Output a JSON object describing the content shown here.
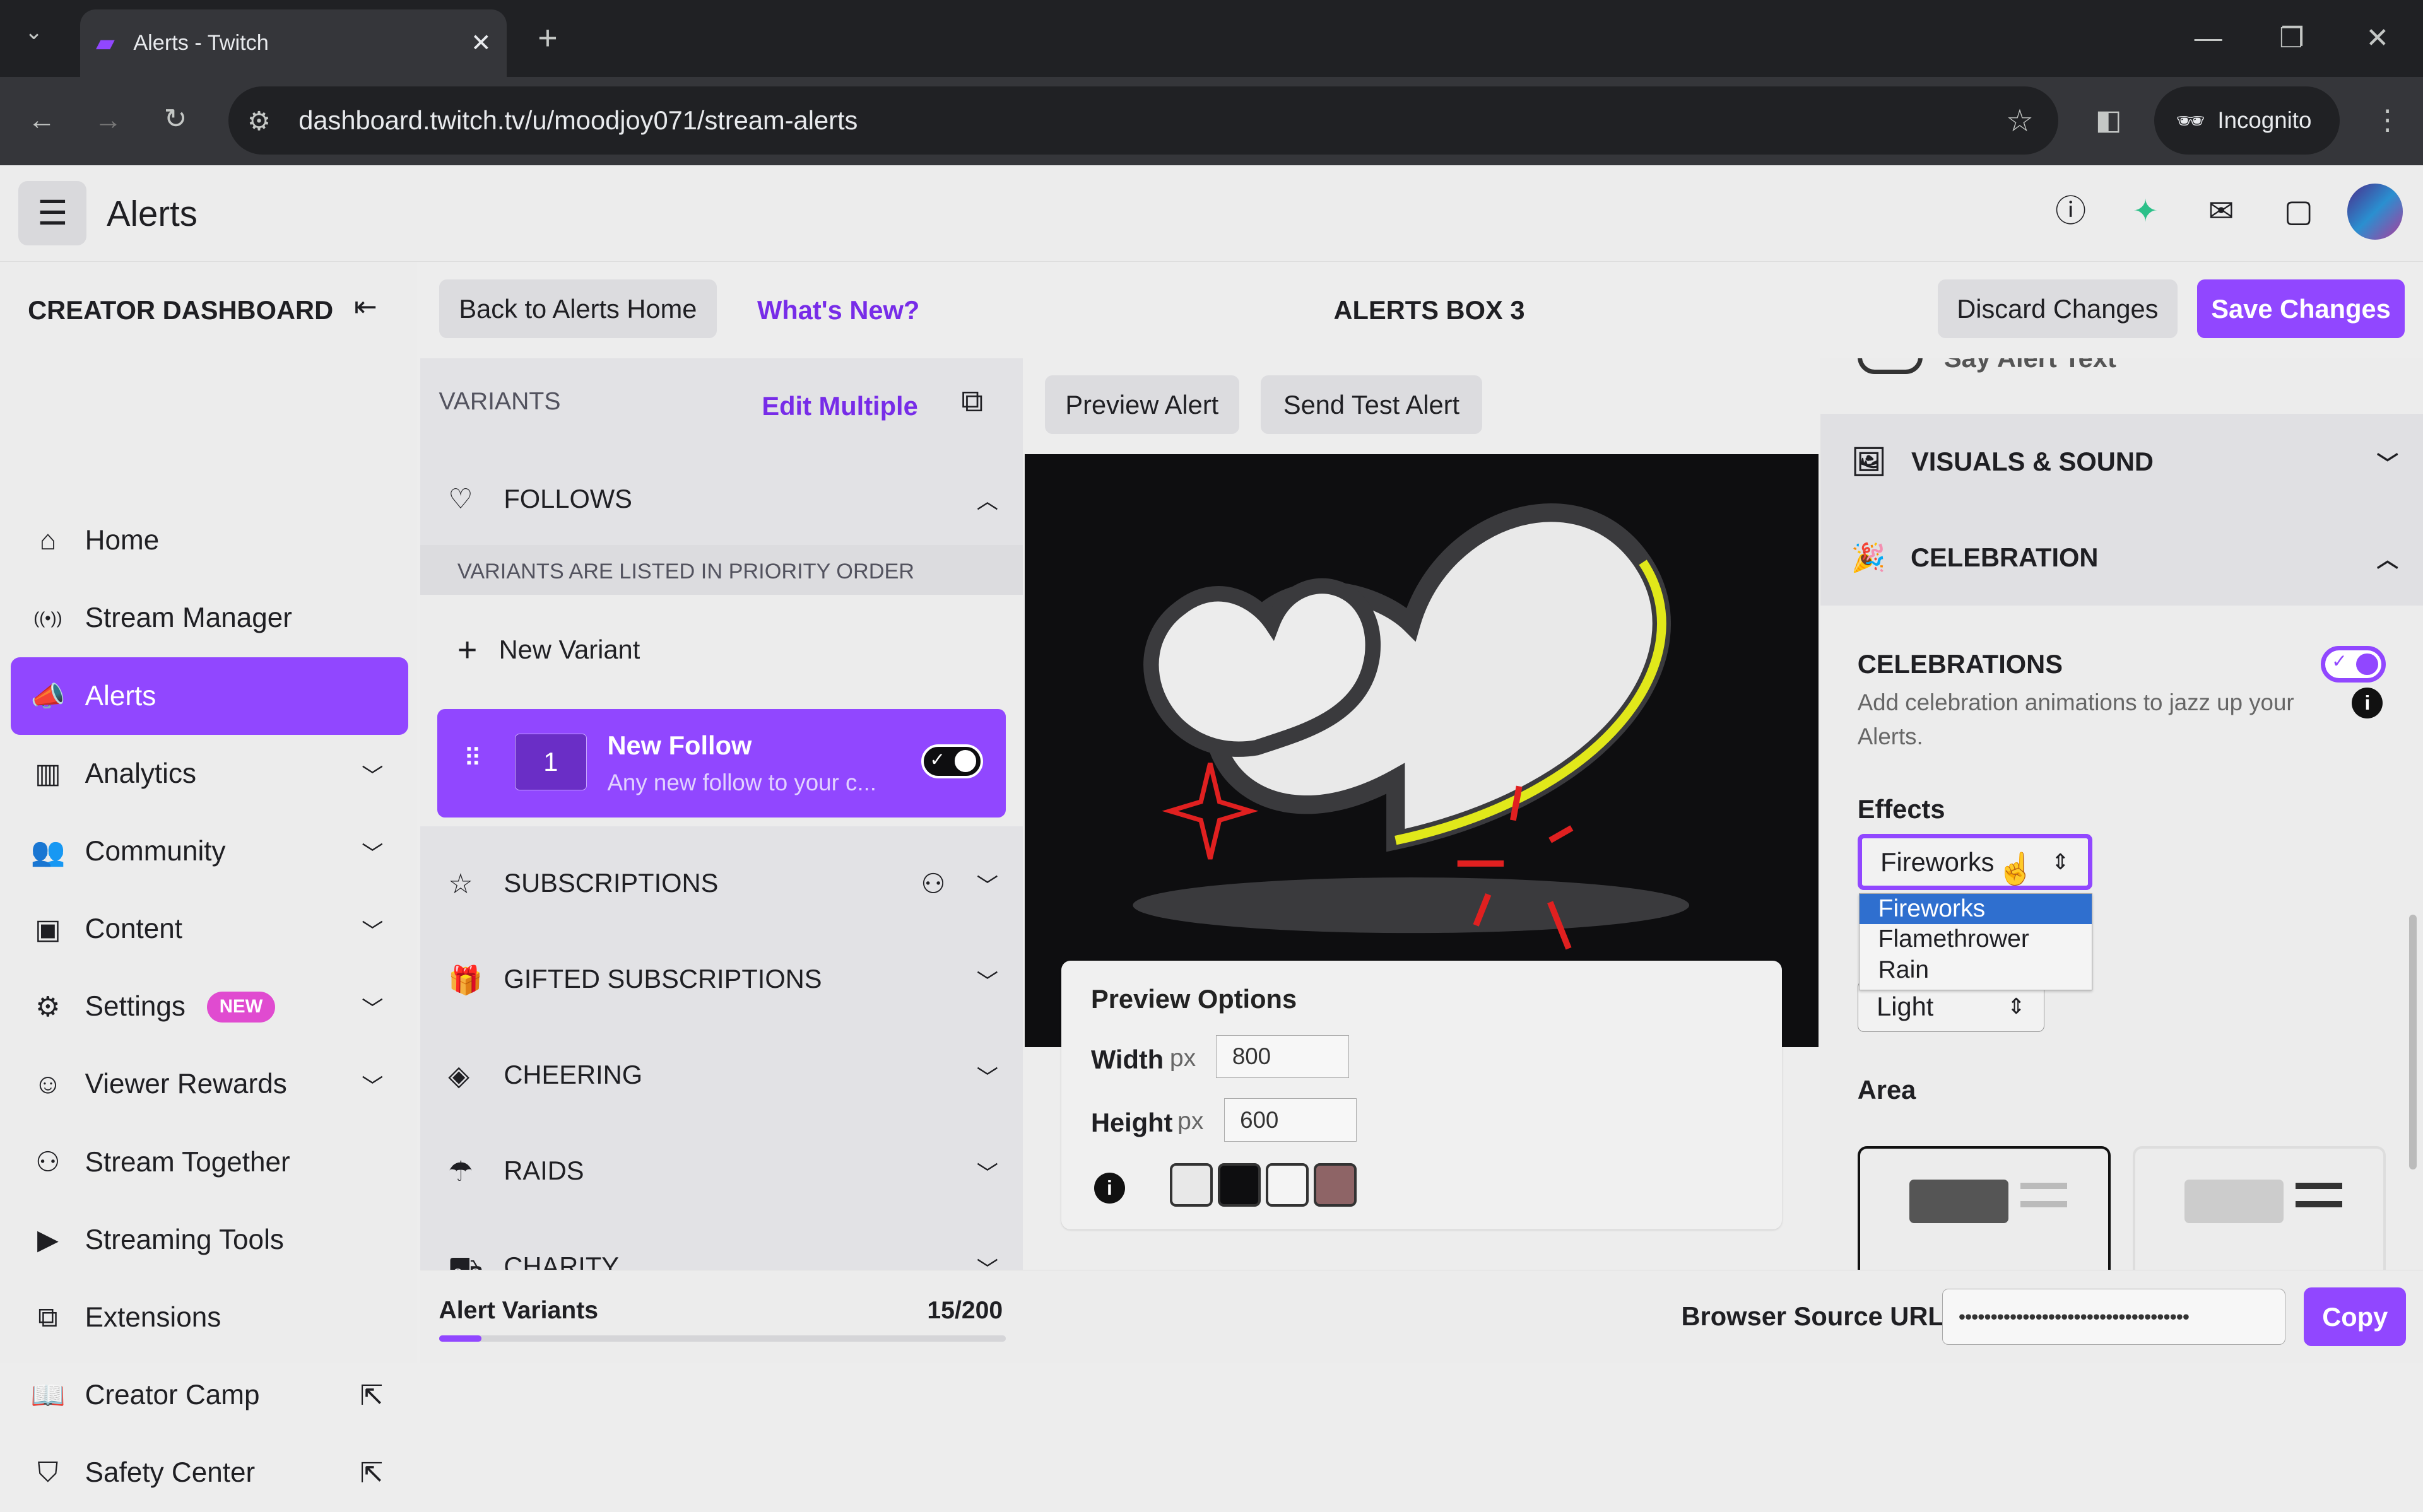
{
  "browser": {
    "tab_title": "Alerts - Twitch",
    "url": "dashboard.twitch.tv/u/moodjoy071/stream-alerts",
    "incognito_label": "Incognito"
  },
  "header": {
    "title": "Alerts"
  },
  "sidebar": {
    "title": "CREATOR DASHBOARD",
    "items": [
      {
        "label": "Home",
        "icon": "home-icon"
      },
      {
        "label": "Stream Manager",
        "icon": "broadcast-icon"
      },
      {
        "label": "Alerts",
        "icon": "megaphone-icon",
        "active": true
      },
      {
        "label": "Analytics",
        "icon": "chart-icon",
        "expandable": true
      },
      {
        "label": "Community",
        "icon": "people-icon",
        "expandable": true
      },
      {
        "label": "Content",
        "icon": "content-icon",
        "expandable": true
      },
      {
        "label": "Settings",
        "icon": "gear-icon",
        "expandable": true,
        "badge": "NEW"
      },
      {
        "label": "Viewer Rewards",
        "icon": "rewards-icon",
        "expandable": true
      },
      {
        "label": "Stream Together",
        "icon": "add-person-icon"
      },
      {
        "label": "Streaming Tools",
        "icon": "camera-icon"
      },
      {
        "label": "Extensions",
        "icon": "puzzle-icon"
      },
      {
        "label": "Creator Camp",
        "icon": "book-icon",
        "external": true
      },
      {
        "label": "Safety Center",
        "icon": "shield-icon",
        "external": true
      }
    ]
  },
  "toolbar": {
    "back": "Back to Alerts Home",
    "whats_new": "What's New?",
    "box_title": "ALERTS BOX 3",
    "discard": "Discard Changes",
    "save": "Save Changes",
    "preview_alert": "Preview Alert",
    "send_test": "Send Test Alert"
  },
  "variants": {
    "title": "VARIANTS",
    "edit_multiple": "Edit Multiple",
    "follows": "FOLLOWS",
    "priority_note": "VARIANTS ARE LISTED IN PRIORITY ORDER",
    "new_variant": "New Variant",
    "card": {
      "number": "1",
      "title": "New Follow",
      "subtitle": "Any new follow to your c...",
      "enabled": true
    },
    "sections": [
      "SUBSCRIPTIONS",
      "GIFTED SUBSCRIPTIONS",
      "CHEERING",
      "RAIDS",
      "CHARITY"
    ]
  },
  "preview_options": {
    "title": "Preview Options",
    "width_label": "Width",
    "height_label": "Height",
    "unit": "px",
    "width": "800",
    "height": "600",
    "swatches": [
      "#e8e8e8",
      "#0e0e10",
      "#f4f4f4",
      "#8e6466"
    ]
  },
  "right": {
    "say_alert_text": "Say Alert Text",
    "visuals": "VISUALS & SOUND",
    "celebration": "CELEBRATION",
    "celebrations_title": "CELEBRATIONS",
    "celebrations_desc": "Add celebration animations to jazz up your Alerts.",
    "celebrations_enabled": true,
    "effects_label": "Effects",
    "effects_value": "Fireworks",
    "effects_options": [
      "Fireworks",
      "Flamethrower",
      "Rain"
    ],
    "intensity_value": "Light",
    "area_label": "Area"
  },
  "bottom": {
    "alert_variants": "Alert Variants",
    "count": "15/200",
    "progress": 0.075,
    "browser_source": "Browser Source URL",
    "url_masked": "••••••••••••••••••••••••••••••••••••",
    "copy": "Copy"
  },
  "colors": {
    "accent": "#9147ff",
    "highlight": "#2f6fcf"
  }
}
